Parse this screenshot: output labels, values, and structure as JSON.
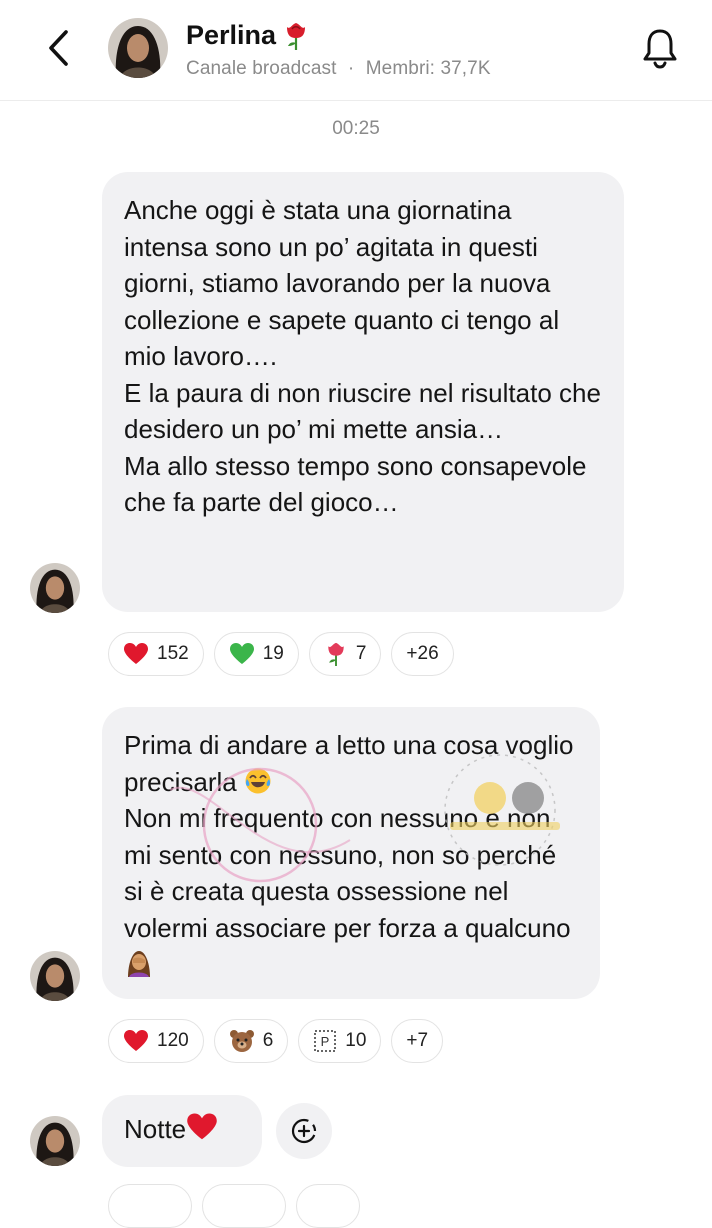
{
  "header": {
    "title": "Perlina",
    "subtitle_type": "Canale broadcast",
    "subtitle_sep": "·",
    "subtitle_members": "Membri: 37,7K"
  },
  "timestamp": "00:25",
  "messages": [
    {
      "paragraphs": [
        "Anche oggi è stata una giornatina intensa sono un po’ agitata in questi giorni, stiamo lavorando per la nuova collezione e sapete quanto ci tengo al mio lavoro….",
        "E la paura di non riuscire nel risultato che desidero un po’ mi mette ansia…",
        "Ma allo stesso tempo sono consapevole che fa parte del gioco…"
      ],
      "reactions": [
        {
          "icon": "red-heart",
          "count": "152"
        },
        {
          "icon": "green-heart",
          "count": "19"
        },
        {
          "icon": "rose",
          "count": "7"
        },
        {
          "icon": "",
          "count": "+26"
        }
      ]
    },
    {
      "paragraphs": [
        "Prima di andare a letto una cosa voglio precisarla",
        "Non mi frequento con nessuno e non mi sento con nessuno, non so perché si è creata questa ossessione nel volermi associare per forza a qualcuno"
      ],
      "emojis": [
        "joy",
        "person-facepalming"
      ],
      "reactions": [
        {
          "icon": "red-heart",
          "count": "120"
        },
        {
          "icon": "bear",
          "count": "6"
        },
        {
          "icon": "p-button",
          "count": "10"
        },
        {
          "icon": "",
          "count": "+7"
        }
      ]
    },
    {
      "paragraphs": [
        "Notte"
      ],
      "emojis": [
        "red-heart"
      ]
    }
  ],
  "colors": {
    "bubble": "#f1f1f3",
    "muted_text": "#8a8a8a",
    "heart_red": "#e0182d",
    "heart_green": "#3bb54a"
  }
}
